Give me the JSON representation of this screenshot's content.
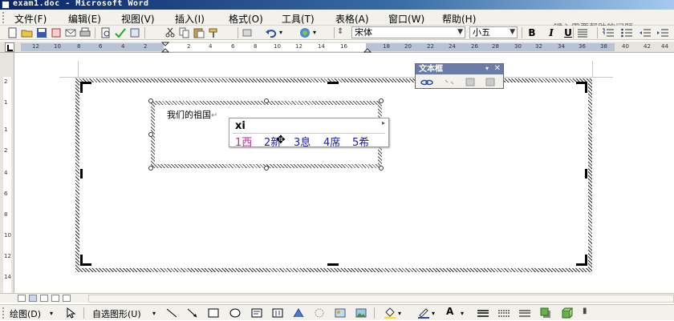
{
  "window": {
    "title": "exam1.doc - Microsoft Word"
  },
  "menu": {
    "items": [
      "文件(F)",
      "编辑(E)",
      "视图(V)",
      "插入(I)",
      "格式(O)",
      "工具(T)",
      "表格(A)",
      "窗口(W)",
      "帮助(H)"
    ],
    "help_placeholder": "键入需要帮助的问题"
  },
  "toolbar": {
    "font_name": "宋体",
    "font_size": "小五",
    "bold_label": "B",
    "italic_label": "I",
    "underline_label": "U"
  },
  "ruler": {
    "left_numbers": [
      "12",
      "10",
      "8",
      "6",
      "4",
      "2"
    ],
    "right_numbers": [
      "2",
      "4",
      "6",
      "8",
      "10",
      "12",
      "14",
      "16",
      "18",
      "20",
      "22",
      "24",
      "26",
      "28",
      "30",
      "32",
      "34",
      "36",
      "38",
      "40",
      "42",
      "44"
    ],
    "vertical_numbers": [
      "2",
      "1",
      "1",
      "2",
      "4",
      "6",
      "8",
      "10",
      "12",
      "14"
    ]
  },
  "document": {
    "textbox_text": "我们的祖国",
    "paragraph_mark": "↵"
  },
  "ime": {
    "input": "xi",
    "candidates": [
      "1西",
      "2新",
      "3息",
      "4席",
      "5希"
    ]
  },
  "textbox_toolbar": {
    "title": "文本框"
  },
  "drawing_toolbar": {
    "draw_label": "绘图(D)",
    "autoshapes_label": "自选图形(U)"
  },
  "colors": {
    "title_gradient_start": "#0a246a",
    "menu_bg": "#f2f1ec",
    "candidate_first": "#c02a9a",
    "candidate_other": "#1a1aa0"
  }
}
